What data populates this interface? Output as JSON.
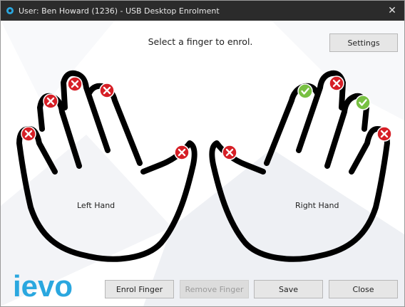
{
  "window": {
    "title": "User: Ben Howard (1236) - USB Desktop Enrolment",
    "close_glyph": "✕"
  },
  "prompt": "Select a finger to enrol.",
  "buttons": {
    "settings": "Settings",
    "enrol": "Enrol Finger",
    "remove": "Remove Finger",
    "save": "Save",
    "close": "Close"
  },
  "hands": {
    "left_label": "Left Hand",
    "right_label": "Right Hand"
  },
  "fingers": [
    {
      "hand": "left",
      "finger": "little",
      "status": "not-enrolled"
    },
    {
      "hand": "left",
      "finger": "ring",
      "status": "not-enrolled"
    },
    {
      "hand": "left",
      "finger": "middle",
      "status": "not-enrolled"
    },
    {
      "hand": "left",
      "finger": "index",
      "status": "not-enrolled"
    },
    {
      "hand": "left",
      "finger": "thumb",
      "status": "not-enrolled"
    },
    {
      "hand": "right",
      "finger": "thumb",
      "status": "not-enrolled"
    },
    {
      "hand": "right",
      "finger": "index",
      "status": "enrolled"
    },
    {
      "hand": "right",
      "finger": "middle",
      "status": "not-enrolled"
    },
    {
      "hand": "right",
      "finger": "ring",
      "status": "enrolled"
    },
    {
      "hand": "right",
      "finger": "little",
      "status": "not-enrolled"
    }
  ],
  "logo_text": "ievo",
  "colors": {
    "not_enrolled": "#d61f26",
    "enrolled": "#78c043",
    "logo": "#2aa7df",
    "titlebar": "#2b2b2b"
  },
  "icons": {
    "app": "app-logo-icon",
    "not_enrolled": "x-circle-icon",
    "enrolled": "check-circle-icon"
  }
}
